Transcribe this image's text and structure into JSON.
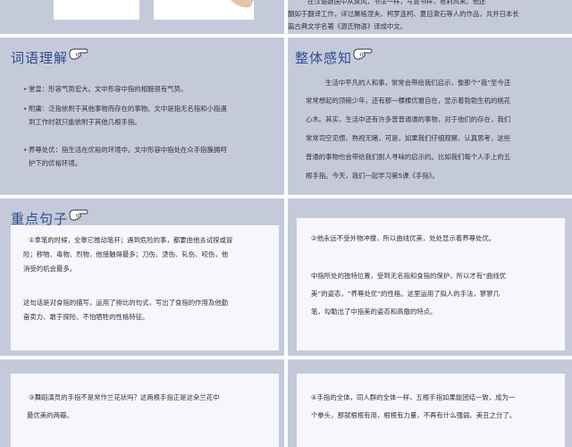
{
  "top_panel": {
    "text_lines": [
      "在汉语鼓国中从戾风，书法一样，写意书样，易莉风来。他还",
      "翻如于翻译工作，详过屠格涅夫、柯罗连柯、夏目漱石等人的作品，共并日本长",
      "篇古典文学名著《源氏物语》译成中文。"
    ]
  },
  "vocab": {
    "title": "词语理解",
    "items": [
      [
        "堂皇：形容气势宏大。文中形容中指的相貌很有气势。"
      ],
      [
        "附庸：泛指依附于其他事物而存在的事物。文中是指无名指和小指遇",
        "到工作时就只能依附于其他几根手指。"
      ],
      [
        "养尊处优：指生活在优裕的环境中。文中形容中指处在众手指簇拥呵",
        "护下的优裕环境。"
      ]
    ]
  },
  "overview": {
    "title": "整体感知",
    "lines": [
      "生活中平凡的人和事，常常会带给我们启示，像那个“我”至今还",
      "常常想起的顶碗少年，还有那一棵棵优雅自在，显示着勃勃生机的桃花",
      "心木。其实，生活中还有许多普普通通的事物，对于他们的存在，我们",
      "常常司空见惯、熟视无睹，可是，如果我们仔细观察、认真思考，这些",
      "普通的事物也会带给我们耐人寻味的启示的。比如我们每个人手上的五",
      "根手指。今天，我们一起学习第5课《手指》。"
    ]
  },
  "key_sentences": {
    "title": "重点句子",
    "card1": {
      "para1": [
        "①拿笔的时候，全靠它推动笔杆；遇到危险的事，都要由他去试探或冒",
        "险；秽物、毒物、烈物，他接触得最多；刀伤、烫伤、轧伤、咬伤，他",
        "消受的机会最多。"
      ],
      "para2": [
        "这句话是对食指的描写，运用了排比的句式，写出了食指的作用及他勤",
        "奋卖力、敢于探险、不怕牺牲的性格特征。"
      ]
    },
    "card2": {
      "para1": [
        "②他永远不受外物冲撞，所以曲线优美，处处显示着养尊处优。"
      ],
      "para2": [
        "中指所处的独特位置，受到无名指和食指的保护，所以才有“曲线优",
        "美”的姿态，“养尊处优”的性格。这里运用了拟人的手法，寥寥几",
        "笔，勾勒出了中指美的姿态和高傲的特点。"
      ]
    },
    "card3": {
      "para1": [
        "③舞蹈演员的手指不是常作兰花状吗？这两根手指正是这朵兰花中",
        "最优美的两瓣。"
      ]
    },
    "card4": {
      "para1": [
        "④手指的全体，同人群的全体一样，五根手指如果能团结一致，成为一",
        "个拳头，那就根根有用，根根有力量，不再有什么强弱、美丑之分了。"
      ]
    }
  },
  "colors": {
    "panel_bg": "#c5cadb",
    "card_bg": "#f7f7fb",
    "heading": "#2f4e8c",
    "body_text": "#333333"
  },
  "icons": [
    "pointing-hand-icon"
  ]
}
